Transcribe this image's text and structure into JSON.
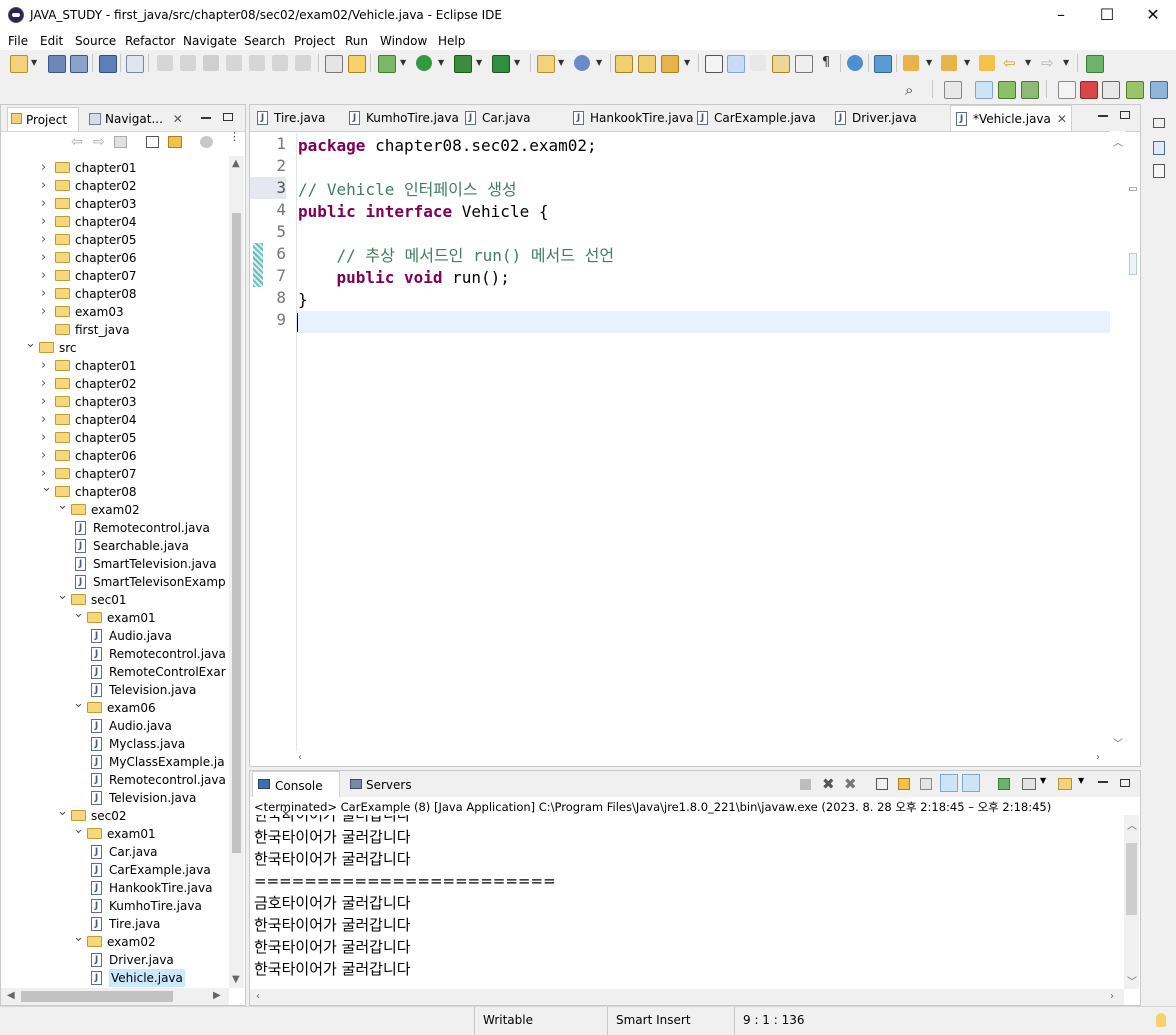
{
  "window": {
    "title": "JAVA_STUDY - first_java/src/chapter08/sec02/exam02/Vehicle.java - Eclipse IDE",
    "minimize": "–",
    "maximize": "☐",
    "close": "✕"
  },
  "menu": [
    "File",
    "Edit",
    "Source",
    "Refactor",
    "Navigate",
    "Search",
    "Project",
    "Run",
    "Window",
    "Help"
  ],
  "left_panel": {
    "tabs": [
      {
        "label": "Project ...",
        "icon": "project-explorer-icon"
      },
      {
        "label": "Navigat...",
        "icon": "navigator-icon",
        "close": "✕"
      }
    ],
    "tree": [
      {
        "label": "chapter01",
        "type": "folder",
        "expanded": false
      },
      {
        "label": "chapter02",
        "type": "folder",
        "expanded": false
      },
      {
        "label": "chapter03",
        "type": "folder",
        "expanded": false
      },
      {
        "label": "chapter04",
        "type": "folder",
        "expanded": false
      },
      {
        "label": "chapter05",
        "type": "folder",
        "expanded": false
      },
      {
        "label": "chapter06",
        "type": "folder",
        "expanded": false
      },
      {
        "label": "chapter07",
        "type": "folder",
        "expanded": false
      },
      {
        "label": "chapter08",
        "type": "folder",
        "expanded": false
      },
      {
        "label": "exam03",
        "type": "folder",
        "expanded": false
      },
      {
        "label": "first_java",
        "type": "folder",
        "expanded": null
      },
      {
        "label": "src",
        "type": "folder",
        "expanded": true
      },
      {
        "label": "chapter01",
        "type": "folder",
        "expanded": false
      },
      {
        "label": "chapter02",
        "type": "folder",
        "expanded": false
      },
      {
        "label": "chapter03",
        "type": "folder",
        "expanded": false
      },
      {
        "label": "chapter04",
        "type": "folder",
        "expanded": false
      },
      {
        "label": "chapter05",
        "type": "folder",
        "expanded": false
      },
      {
        "label": "chapter06",
        "type": "folder",
        "expanded": false
      },
      {
        "label": "chapter07",
        "type": "folder",
        "expanded": false
      },
      {
        "label": "chapter08",
        "type": "folder",
        "expanded": true
      },
      {
        "label": "exam02",
        "type": "folder",
        "expanded": true
      },
      {
        "label": "Remotecontrol.java",
        "type": "file"
      },
      {
        "label": "Searchable.java",
        "type": "file"
      },
      {
        "label": "SmartTelevision.java",
        "type": "file"
      },
      {
        "label": "SmartTelevisonExamp",
        "type": "file"
      },
      {
        "label": "sec01",
        "type": "folder",
        "expanded": true
      },
      {
        "label": "exam01",
        "type": "folder",
        "expanded": true
      },
      {
        "label": "Audio.java",
        "type": "file"
      },
      {
        "label": "Remotecontrol.java",
        "type": "file"
      },
      {
        "label": "RemoteControlExar",
        "type": "file"
      },
      {
        "label": "Television.java",
        "type": "file"
      },
      {
        "label": "exam06",
        "type": "folder",
        "expanded": true
      },
      {
        "label": "Audio.java",
        "type": "file"
      },
      {
        "label": "Myclass.java",
        "type": "file"
      },
      {
        "label": "MyClassExample.ja",
        "type": "file"
      },
      {
        "label": "Remotecontrol.java",
        "type": "file"
      },
      {
        "label": "Television.java",
        "type": "file"
      },
      {
        "label": "sec02",
        "type": "folder",
        "expanded": true
      },
      {
        "label": "exam01",
        "type": "folder",
        "expanded": true
      },
      {
        "label": "Car.java",
        "type": "file"
      },
      {
        "label": "CarExample.java",
        "type": "file"
      },
      {
        "label": "HankookTire.java",
        "type": "file"
      },
      {
        "label": "KumhoTire.java",
        "type": "file"
      },
      {
        "label": "Tire.java",
        "type": "file"
      },
      {
        "label": "exam02",
        "type": "folder",
        "expanded": true
      },
      {
        "label": "Driver.java",
        "type": "file"
      },
      {
        "label": "Vehicle.java",
        "type": "file",
        "selected": true
      }
    ]
  },
  "editor": {
    "tabs": [
      {
        "label": "Tire.java",
        "active": false
      },
      {
        "label": "KumhoTire.java",
        "active": false
      },
      {
        "label": "Car.java",
        "active": false
      },
      {
        "label": "HankookTire.java",
        "active": false
      },
      {
        "label": "CarExample.java",
        "active": false
      },
      {
        "label": "Driver.java",
        "active": false
      },
      {
        "label": "*Vehicle.java",
        "active": true,
        "close": "✕"
      }
    ],
    "lines": [
      {
        "num": "1",
        "segments": [
          {
            "t": "package",
            "k": "kw"
          },
          {
            "t": " chapter08.sec02.exam02;",
            "k": ""
          }
        ]
      },
      {
        "num": "2",
        "segments": []
      },
      {
        "num": "3",
        "segments": [
          {
            "t": "// Vehicle 인터페이스 생성",
            "k": "cm"
          }
        ]
      },
      {
        "num": "4",
        "segments": [
          {
            "t": "public",
            "k": "kw"
          },
          {
            "t": " ",
            "k": ""
          },
          {
            "t": "interface",
            "k": "kw"
          },
          {
            "t": " Vehicle {",
            "k": ""
          }
        ]
      },
      {
        "num": "5",
        "segments": []
      },
      {
        "num": "6",
        "segments": [
          {
            "t": "    // 추상 메서드인 run() 메서드 선언",
            "k": "cm"
          }
        ]
      },
      {
        "num": "7",
        "segments": [
          {
            "t": "    ",
            "k": ""
          },
          {
            "t": "public",
            "k": "kw"
          },
          {
            "t": " ",
            "k": ""
          },
          {
            "t": "void",
            "k": "kw"
          },
          {
            "t": " run();",
            "k": ""
          }
        ]
      },
      {
        "num": "8",
        "segments": [
          {
            "t": "}",
            "k": ""
          }
        ]
      },
      {
        "num": "9",
        "segments": []
      }
    ],
    "current_line": 9
  },
  "console": {
    "tabs": [
      {
        "label": "Console",
        "active": true,
        "close": "✕"
      },
      {
        "label": "Servers",
        "active": false
      }
    ],
    "status": "<terminated> CarExample (8) [Java Application] C:\\Program Files\\Java\\jre1.8.0_221\\bin\\javaw.exe  (2023. 8. 28 오후 2:18:45 – 오후 2:18:45)",
    "output": [
      "한국타이어가 굴러갑니다",
      "한국타이어가 굴러갑니다",
      "한국타이어가 굴러갑니다",
      "========================",
      "금호타이어가 굴러갑니다",
      "한국타이어가 굴러갑니다",
      "한국타이어가 굴러갑니다",
      "한국타이어가 굴러갑니다"
    ]
  },
  "statusbar": {
    "writable": "Writable",
    "insert_mode": "Smart Insert",
    "position": "9 : 1 : 136"
  },
  "colors": {
    "keyword": "#7f0055",
    "comment": "#3f7f5f",
    "selection": "#cce8ff",
    "current_line": "#e8f2fe"
  }
}
